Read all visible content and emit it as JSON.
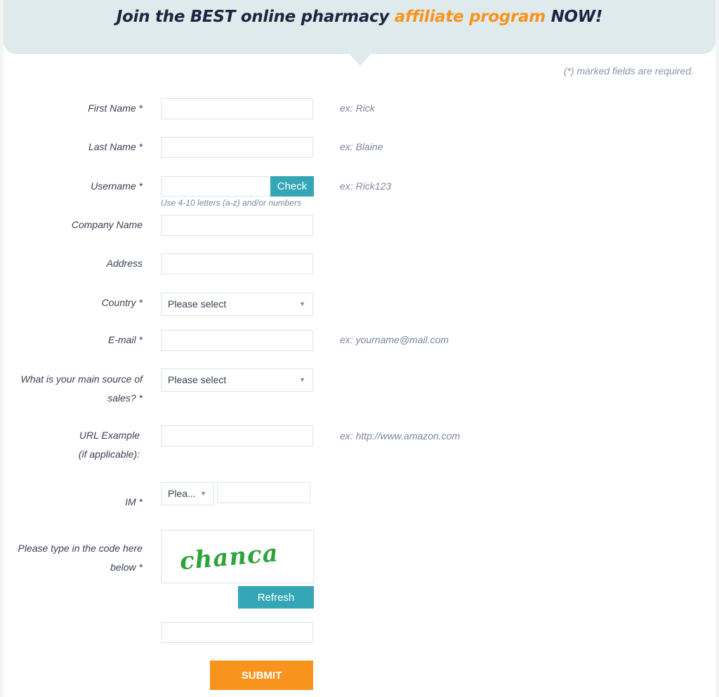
{
  "banner": {
    "title_part1": "Join the BEST online pharmacy ",
    "title_highlight": "affiliate program",
    "title_part2": " NOW!"
  },
  "required_note": "(*) marked fields are required.",
  "fields": {
    "first_name": {
      "label": "First Name *",
      "value": "",
      "hint": "ex: Rick"
    },
    "last_name": {
      "label": "Last Name *",
      "value": "",
      "hint": "ex: Blaine"
    },
    "username": {
      "label": "Username *",
      "value": "",
      "hint": "ex: Rick123",
      "check_label": "Check",
      "subhint": "Use 4-10 letters (a-z) and/or numbers"
    },
    "company": {
      "label": "Company Name",
      "value": ""
    },
    "address": {
      "label": "Address",
      "value": ""
    },
    "country": {
      "label": "Country *",
      "selected": "Please select"
    },
    "email": {
      "label": "E-mail *",
      "value": "",
      "hint": "ex: yourname@mail.com"
    },
    "sales_source": {
      "label_line1": "What is your main source of",
      "label_line2": "sales? *",
      "selected": "Please select"
    },
    "url_example": {
      "label_line1": "URL Example",
      "label_line2": "(if applicable):",
      "value": "",
      "hint": "ex: http://www.amazon.com"
    },
    "im": {
      "label": "IM *",
      "selected": "Plea...",
      "value": ""
    },
    "captcha": {
      "label_line1": "Please type in the code here",
      "label_line2": "below *",
      "image_text": "chanca",
      "refresh_label": "Refresh",
      "value": ""
    }
  },
  "submit_label": "SUBMIT",
  "colors": {
    "accent_teal": "#35a6b5",
    "accent_orange": "#f7941d",
    "banner_bg": "#dfeaed",
    "captcha_green": "#2ea33a"
  },
  "icons": {
    "select_caret": "▼"
  }
}
